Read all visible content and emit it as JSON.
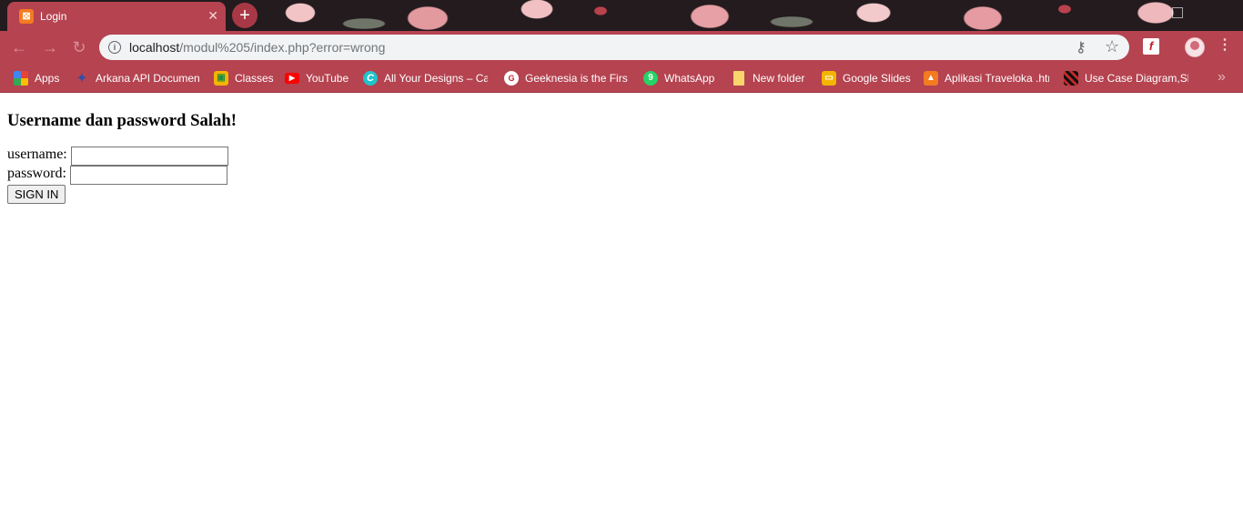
{
  "browser": {
    "tab": {
      "title": "Login",
      "favicon": "xampp-icon"
    },
    "address_bar": {
      "host": "localhost",
      "path": "/modul%205/index.php?error=wrong"
    },
    "bookmarks": [
      {
        "label": "Apps",
        "icon": "apps-grid-icon"
      },
      {
        "label": "Arkana API Documen",
        "icon": "hummingbird-icon"
      },
      {
        "label": "Classes",
        "icon": "google-classroom-icon"
      },
      {
        "label": "YouTube",
        "icon": "youtube-icon"
      },
      {
        "label": "All Your Designs – Ca",
        "icon": "canva-icon"
      },
      {
        "label": "Geeknesia is the First",
        "icon": "geeknesia-icon"
      },
      {
        "label": "WhatsApp",
        "icon": "whatsapp-icon"
      },
      {
        "label": "New folder",
        "icon": "document-icon"
      },
      {
        "label": "Google Slides",
        "icon": "google-slides-icon"
      },
      {
        "label": "Aplikasi Traveloka .htm",
        "icon": "shapes-icon"
      },
      {
        "label": "Use Case Diagram,Sk",
        "icon": "pattern-icon"
      }
    ],
    "colors": {
      "frame": "#b54350",
      "tab_background": "#231b1e"
    }
  },
  "page": {
    "heading": "Username dan password Salah!",
    "username_label": "username:",
    "password_label": "password:",
    "submit_label": "SIGN IN"
  }
}
